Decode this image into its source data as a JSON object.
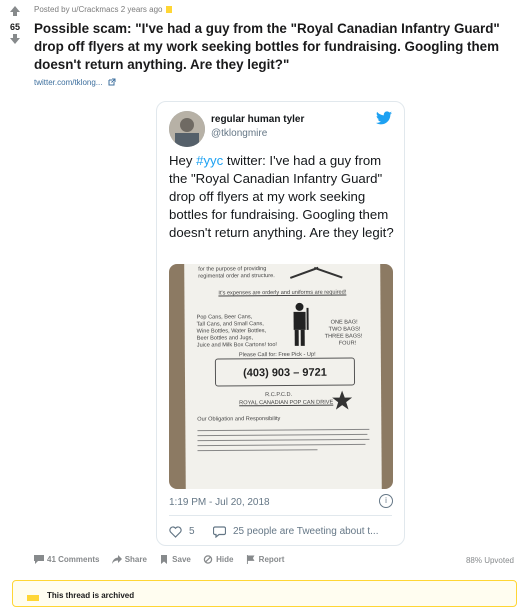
{
  "post": {
    "score": "65",
    "meta": "Posted by u/Crackmacs 2 years ago",
    "title": "Possible scam: \"I've had a guy from the \"Royal Canadian Infantry Guard\" drop off flyers at my work seeking bottles for fundraising. Googling them doesn't return anything. Are they legit?\"",
    "link": "twitter.com/tklong..."
  },
  "tweet": {
    "name": "regular human tyler",
    "handle": "@tklongmire",
    "text_before": "Hey ",
    "hashtag": "#yyc",
    "text_after": " twitter: I've had a guy from the \"Royal Canadian Infantry Guard\" drop off flyers at my work seeking bottles for fundraising. Googling them doesn't return anything. Are they legit?",
    "time": "1:19 PM - Jul 20, 2018",
    "likes": "5",
    "tweeting": "25 people are Tweeting about t...",
    "flyer": {
      "line1": "for the purpose of providing",
      "line2": "regimental order and structure.",
      "expenses": "It's expenses are orderly and uniforms are required!",
      "items1": "Pop Cans, Beer Cans,",
      "items2": "Tall Cans, and Small Cans,",
      "items3": "Wine Bottles, Water Bottles,",
      "items4": "Beer Bottles and Jugs,",
      "items5": "Juice and Milk Box Cartons! too!",
      "bags1": "ONE BAG!",
      "bags2": "TWO BAGS!",
      "bags3": "THREE BAGS!",
      "bags4": "FOUR!",
      "call": "Please Call for: Free Pick - Up!",
      "phone": "(403) 903 – 9721",
      "org1": "R.C.P.C.D.",
      "org2": "ROYAL CANADIAN POP CAN DRIVE",
      "oblig": "Our Obligation and Responsibility"
    }
  },
  "actions": {
    "comments": "41 Comments",
    "share": "Share",
    "save": "Save",
    "hide": "Hide",
    "report": "Report",
    "upvoted": "88% Upvoted"
  },
  "banner": {
    "text": "This thread is archived"
  },
  "colors": {
    "link": "#3d6f9e",
    "twitter_blue": "#1da1f2",
    "archive_yellow": "#ffd635"
  }
}
